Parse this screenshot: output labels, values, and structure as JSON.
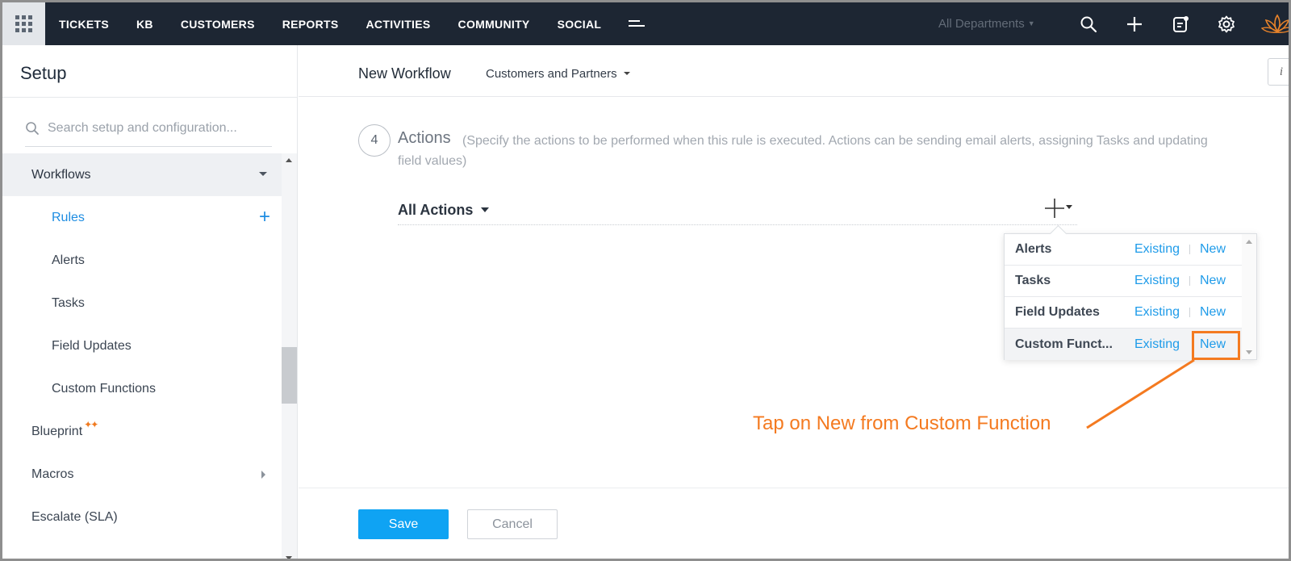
{
  "topnav": {
    "items": [
      "TICKETS",
      "KB",
      "CUSTOMERS",
      "REPORTS",
      "ACTIVITIES",
      "COMMUNITY",
      "SOCIAL"
    ],
    "department": "All Departments",
    "icons": [
      "app-grid-icon",
      "more-menu-icon",
      "search-icon",
      "plus-icon",
      "notes-icon",
      "gear-icon",
      "brand-logo"
    ]
  },
  "sidebar": {
    "title": "Setup",
    "search_placeholder": "Search setup and configuration...",
    "group": "Workflows",
    "sub_items": [
      "Rules",
      "Alerts",
      "Tasks",
      "Field Updates",
      "Custom Functions"
    ],
    "other_items": [
      "Blueprint",
      "Macros",
      "Escalate (SLA)"
    ],
    "sparkle": "✦✦"
  },
  "main": {
    "title": "New Workflow",
    "layout": "Customers and Partners",
    "info": "i",
    "step_number": "4",
    "actions_title": "Actions",
    "actions_desc": "(Specify the actions to be performed when this rule is executed. Actions can be sending email alerts, assigning Tasks and updating field values)",
    "all_actions": "All Actions",
    "dropdown": {
      "existing_label": "Existing",
      "new_label": "New",
      "rows": [
        "Alerts",
        "Tasks",
        "Field Updates",
        "Custom Funct..."
      ]
    },
    "callout": "Tap on New from Custom Function",
    "save": "Save",
    "cancel": "Cancel"
  },
  "colors": {
    "nav_bg": "#1d2633",
    "accent_blue": "#1e9be9",
    "save_blue": "#0fa3f3",
    "annotation_orange": "#f47a20"
  }
}
